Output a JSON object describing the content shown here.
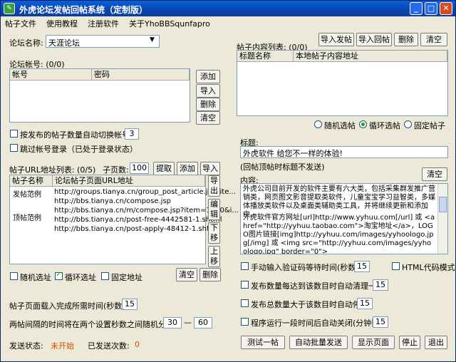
{
  "title": "外虎论坛发帖回帖系统（定制版）",
  "menu": [
    "帖子文件",
    "使用教程",
    "注册软件",
    "关于YhoBBSqunfapro"
  ],
  "forum": {
    "label": "论坛名称:",
    "value": "天涯论坛"
  },
  "accounts": {
    "label": "论坛帐号: (0/0)",
    "col1": "帐号",
    "col2": "密码",
    "buttons": [
      "添加",
      "导入",
      "删除",
      "清空"
    ]
  },
  "auto_switch": {
    "label": "按发布的帖子数量自动切换帐号:",
    "value": "3"
  },
  "skip_login": "跳过帐号登录（已处于登录状态）",
  "url_list": {
    "label": "帖子URL地址列表: (0/5)",
    "page_label": "子页数:",
    "page_value": "100",
    "extract": "提取",
    "add": "添加",
    "import": "导入",
    "col1": "帖子名称",
    "col2": "论坛帖子页面URL地址",
    "rows": [
      {
        "name": "发帖范例",
        "url": "http://groups.tianya.cn/group_post_article.jsp?ite..."
      },
      {
        "name": "",
        "url": "http://bbs.tianya.cn/compose.jsp"
      },
      {
        "name": "",
        "url": "http://bbs.tianya.cn/m/compose.jsp?item=1140&i..."
      },
      {
        "name": "顶帖范例",
        "url": "http://bbs.tianya.cn/post-free-4442581-1.shtml"
      },
      {
        "name": "",
        "url": "http://bbs.tianya.cn/post-apply-48412-1.shtml"
      }
    ],
    "side_buttons": [
      "导出",
      "编辑",
      "下移",
      "上移"
    ],
    "options": [
      "随机选址",
      "循环选址",
      "固定地址"
    ],
    "clear": "清空",
    "delete": "删除"
  },
  "page_load": {
    "label": "帖子页面载入完成所需时间(秒数)",
    "value": "15"
  },
  "interval": {
    "label": "两帖间隔的时间将在两个设置秒数之间随机分配",
    "min": "30",
    "dash": "—",
    "max": "60"
  },
  "status": {
    "send_label": "发送状态:",
    "send_value": "未开始",
    "count_label": "已发送次数:",
    "count_value": "0"
  },
  "content_list": {
    "label": "帖子内容列表: (0/0)",
    "buttons": [
      "导入发帖",
      "导入回帖",
      "删除",
      "清空"
    ],
    "col1": "标题名称",
    "col2": "本地帖子内容地址"
  },
  "post_mode": [
    "随机选帖",
    "循环选帖",
    "固定帖子"
  ],
  "title_field": {
    "label": "标题:",
    "value": "外虎软件 给您不一样的体验!"
  },
  "reply_note": "(回帖顶帖时标题不发送)",
  "content": {
    "label": "内容:",
    "clear": "清空",
    "text1": "外虎公司目前开发的软件主要有六大类，包括采集群发推广营销类，网页图文影音提取类软件，儿童宝宝学习益智类，多媒体播放类软件以及桌面类辅助类工具，并将继续更新和添加中。",
    "text2": "外虎软件官方网址[url]http://www.yyhuu.com[/url] 或 <a href=\"http://yyhuu.taobao.com\">淘宝地址</a>，LOGO图片链接[img]http://yyhuu.com/images/yyhoologo.jpg[/img] 或 <img src=\"http://yyhuu.com/images/yyhoologo.jpg\" border=\"0\">"
  },
  "captcha": {
    "label": "手动输入验证码等待时间(秒数)",
    "value": "15"
  },
  "html_mode": "HTML代码模式",
  "clear_after": {
    "label": "发布数量每达到该数目时自动清理一次",
    "value": "15"
  },
  "stop_after": {
    "label": "发布总数量大于该数目时自动停止",
    "value": "15"
  },
  "auto_close": {
    "label": "程序运行一段时间后自动关闭(分钟数)",
    "value": "15"
  },
  "bottom_buttons": [
    "测试一帖",
    "自动批量发送",
    "显示页面",
    "停止",
    "退出"
  ],
  "colors": {
    "titlebar": "#0a4bc4",
    "status_value": "#d05000"
  }
}
